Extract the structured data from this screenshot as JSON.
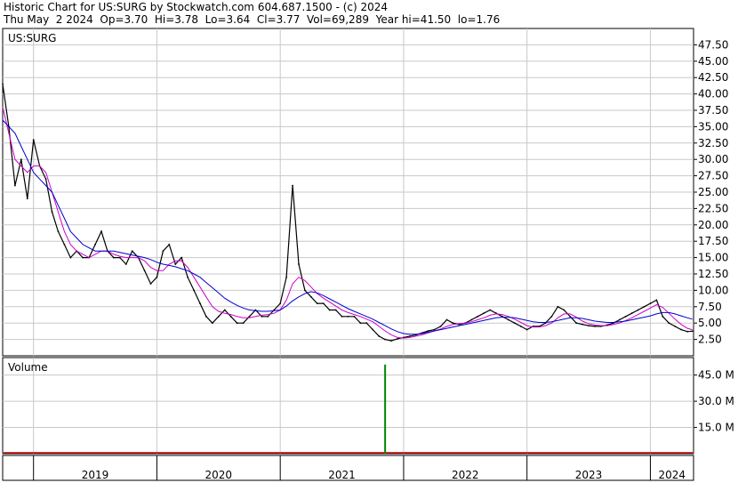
{
  "header": {
    "line1": "Historic Chart for US:SURG by Stockwatch.com 604.687.1500 - (c) 2024",
    "line2": "Thu May  2 2024  Op=3.70  Hi=3.78  Lo=3.64  Cl=3.77  Vol=69,289  Year hi=41.50  lo=1.76"
  },
  "colors": {
    "price": "#000000",
    "ma_short": "#cc00cc",
    "ma_long": "#0000cc",
    "volume": "#008800",
    "volume_alt": "#cc0000",
    "grid": "#c8c8c8"
  },
  "chart_data": [
    {
      "type": "line",
      "title": "US:SURG",
      "ylim": [
        0,
        50
      ],
      "yticks": [
        "47.50",
        "45.00",
        "42.50",
        "40.00",
        "37.50",
        "35.00",
        "32.50",
        "30.00",
        "27.50",
        "25.00",
        "22.50",
        "20.00",
        "17.50",
        "15.00",
        "12.50",
        "10.00",
        "7.50",
        "5.00",
        "2.50"
      ],
      "x_labels": [
        "2019",
        "2020",
        "2021",
        "2022",
        "2023",
        "2024"
      ],
      "grid": true,
      "x": [
        2018.75,
        2018.8,
        2018.85,
        2018.9,
        2018.95,
        2019.0,
        2019.05,
        2019.1,
        2019.15,
        2019.2,
        2019.25,
        2019.3,
        2019.35,
        2019.4,
        2019.45,
        2019.5,
        2019.55,
        2019.6,
        2019.65,
        2019.7,
        2019.75,
        2019.8,
        2019.85,
        2019.9,
        2019.95,
        2020.0,
        2020.05,
        2020.1,
        2020.15,
        2020.2,
        2020.25,
        2020.3,
        2020.35,
        2020.4,
        2020.45,
        2020.5,
        2020.55,
        2020.6,
        2020.65,
        2020.7,
        2020.75,
        2020.8,
        2020.85,
        2020.9,
        2020.95,
        2021.0,
        2021.05,
        2021.1,
        2021.15,
        2021.2,
        2021.25,
        2021.3,
        2021.35,
        2021.4,
        2021.45,
        2021.5,
        2021.55,
        2021.6,
        2021.65,
        2021.7,
        2021.75,
        2021.8,
        2021.85,
        2021.9,
        2021.95,
        2022.0,
        2022.05,
        2022.1,
        2022.15,
        2022.2,
        2022.25,
        2022.3,
        2022.35,
        2022.4,
        2022.45,
        2022.5,
        2022.55,
        2022.6,
        2022.65,
        2022.7,
        2022.75,
        2022.8,
        2022.85,
        2022.9,
        2022.95,
        2023.0,
        2023.05,
        2023.1,
        2023.15,
        2023.2,
        2023.25,
        2023.3,
        2023.35,
        2023.4,
        2023.45,
        2023.5,
        2023.55,
        2023.6,
        2023.65,
        2023.7,
        2023.75,
        2023.8,
        2023.85,
        2023.9,
        2023.95,
        2024.0,
        2024.05,
        2024.1,
        2024.15,
        2024.2,
        2024.25,
        2024.3,
        2024.34
      ],
      "series": [
        {
          "values": [
            41.5,
            35,
            26,
            30,
            24,
            33,
            29,
            27,
            22,
            19,
            17,
            15,
            16,
            15,
            15,
            17,
            19,
            16,
            15,
            15,
            14,
            16,
            15,
            13,
            11,
            12,
            16,
            17,
            14,
            15,
            12,
            10,
            8,
            6,
            5,
            6,
            7,
            6,
            5,
            5,
            6,
            7,
            6,
            6,
            7,
            8,
            12,
            26,
            14,
            10,
            9,
            8,
            8,
            7,
            7,
            6,
            6,
            6,
            5,
            5,
            4,
            3,
            2.5,
            2.3,
            2.6,
            2.8,
            3,
            3.2,
            3.5,
            3.8,
            4,
            4.5,
            5.5,
            5,
            4.8,
            5,
            5.5,
            6,
            6.5,
            7,
            6.5,
            6,
            5.5,
            5,
            4.5,
            4,
            4.5,
            4.5,
            5,
            6,
            7.5,
            7,
            6,
            5,
            4.8,
            4.6,
            4.5,
            4.5,
            4.7,
            5,
            5.5,
            6,
            6.5,
            7,
            7.5,
            8,
            8.5,
            6,
            5,
            4.5,
            4,
            3.7,
            3.77
          ]
        },
        {
          "values": [
            38,
            34,
            30,
            29,
            28,
            29,
            29,
            28,
            25,
            22,
            19,
            17,
            16,
            15.5,
            15,
            15.5,
            16,
            16,
            15.5,
            15.2,
            15,
            15,
            15,
            14.5,
            13.5,
            13,
            13,
            14,
            14.5,
            14.5,
            13.5,
            12,
            10.5,
            9,
            7.5,
            6.8,
            6.5,
            6.3,
            6,
            5.8,
            5.8,
            6,
            6.2,
            6.3,
            6.5,
            7,
            8.5,
            11,
            12,
            11.5,
            10.5,
            9.5,
            8.8,
            8.2,
            7.6,
            7,
            6.6,
            6.3,
            6,
            5.6,
            5.2,
            4.5,
            3.8,
            3.2,
            2.8,
            2.7,
            2.8,
            3,
            3.2,
            3.5,
            3.8,
            4.1,
            4.5,
            4.8,
            4.9,
            5,
            5.2,
            5.5,
            5.8,
            6.2,
            6.4,
            6.3,
            6,
            5.6,
            5.1,
            4.6,
            4.4,
            4.4,
            4.6,
            5,
            5.8,
            6.4,
            6.4,
            5.9,
            5.3,
            4.9,
            4.7,
            4.6,
            4.6,
            4.8,
            5,
            5.4,
            5.8,
            6.3,
            6.8,
            7.3,
            7.8,
            7.4,
            6.5,
            5.6,
            4.8,
            4.2,
            4
          ]
        },
        {
          "values": [
            36,
            35,
            34,
            32,
            30,
            28,
            27,
            26,
            25,
            23,
            21,
            19,
            18,
            17,
            16.5,
            16,
            16,
            16,
            16,
            15.8,
            15.6,
            15.4,
            15.2,
            15,
            14.7,
            14.3,
            14,
            13.8,
            13.6,
            13.3,
            13,
            12.5,
            12,
            11.2,
            10.4,
            9.6,
            8.8,
            8.2,
            7.7,
            7.3,
            7,
            6.9,
            6.8,
            6.8,
            6.9,
            7,
            7.6,
            8.4,
            9,
            9.5,
            9.8,
            9.6,
            9.2,
            8.7,
            8.2,
            7.7,
            7.2,
            6.8,
            6.4,
            6,
            5.6,
            5.1,
            4.6,
            4.1,
            3.7,
            3.4,
            3.3,
            3.3,
            3.4,
            3.6,
            3.8,
            4,
            4.2,
            4.4,
            4.6,
            4.8,
            5,
            5.2,
            5.4,
            5.6,
            5.8,
            5.9,
            5.9,
            5.8,
            5.6,
            5.4,
            5.2,
            5.1,
            5.1,
            5.2,
            5.4,
            5.6,
            5.8,
            5.8,
            5.7,
            5.5,
            5.3,
            5.2,
            5.1,
            5.1,
            5.2,
            5.3,
            5.5,
            5.7,
            5.9,
            6.1,
            6.4,
            6.6,
            6.6,
            6.4,
            6.1,
            5.8,
            5.6
          ]
        }
      ]
    },
    {
      "type": "bar",
      "title": "Volume",
      "ylim": [
        0,
        55
      ],
      "yticks": [
        "45.0 M",
        "30.0 M",
        "15.0 M"
      ],
      "x": [
        2021.85
      ],
      "values": [
        51
      ],
      "baseline": 0.5
    }
  ]
}
